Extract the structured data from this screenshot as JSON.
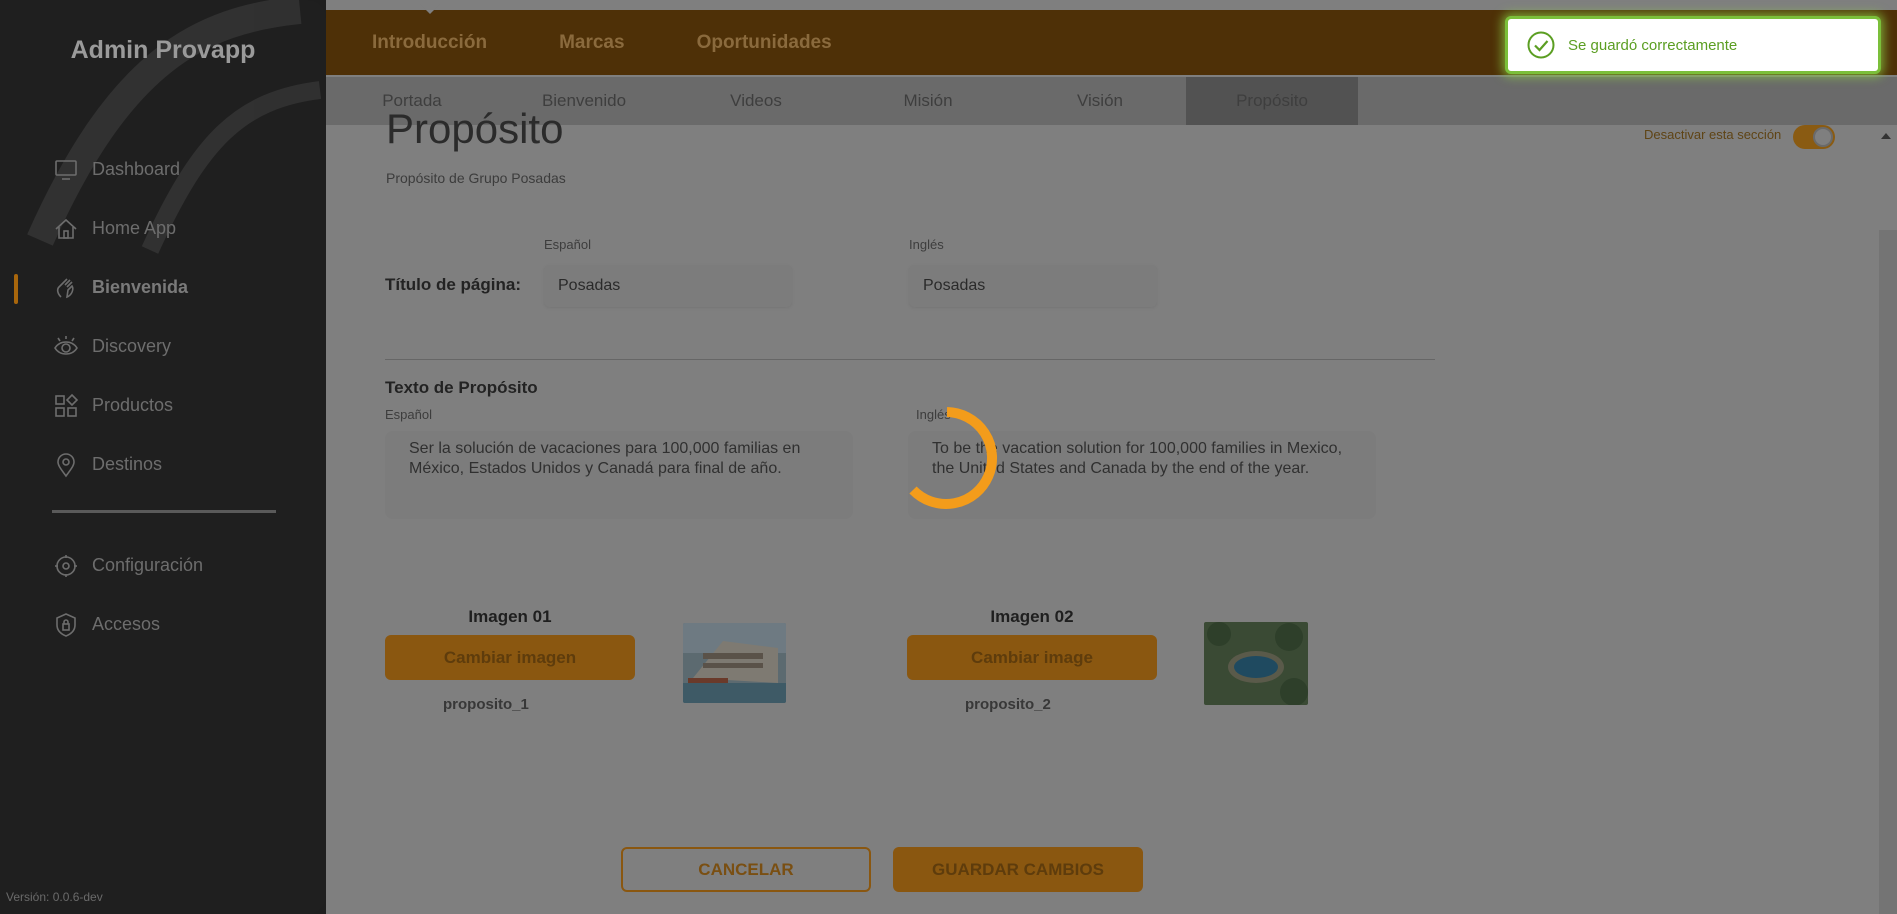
{
  "app": {
    "brand": "Admin Provapp",
    "version": "Versión: 0.0.6-dev"
  },
  "sidebar": {
    "items": [
      {
        "label": "Dashboard",
        "icon": "monitor-icon"
      },
      {
        "label": "Home App",
        "icon": "home-icon"
      },
      {
        "label": "Bienvenida",
        "icon": "wave-hand-icon",
        "active": true
      },
      {
        "label": "Discovery",
        "icon": "eye-icon"
      },
      {
        "label": "Productos",
        "icon": "grid-shapes-icon"
      },
      {
        "label": "Destinos",
        "icon": "location-pin-icon"
      }
    ],
    "secondary": [
      {
        "label": "Configuración",
        "icon": "gear-icon"
      },
      {
        "label": "Accesos",
        "icon": "shield-lock-icon"
      }
    ]
  },
  "topnav": {
    "tabs": [
      "Introducción",
      "Marcas",
      "Oportunidades"
    ],
    "active": "Introducción"
  },
  "subnav": {
    "tabs": [
      "Portada",
      "Bienvenido",
      "Videos",
      "Misión",
      "Visión",
      "Propósito"
    ],
    "active": "Propósito"
  },
  "page": {
    "title": "Propósito",
    "subtitle": "Propósito de Grupo Posadas",
    "toggle_label": "Desactivar esta sección"
  },
  "form": {
    "title_label": "Título de página:",
    "lang_es": "Español",
    "lang_en": "Inglés",
    "title_es": "Posadas",
    "title_en": "Posadas",
    "text_label": "Texto de Propósito",
    "text_lang_es": "Español",
    "text_lang_en": "Inglés",
    "text_es": "Ser la solución de vacaciones para 100,000 familias en México, Estados Unidos y Canadá para final de año.",
    "text_en": "To be the vacation solution for 100,000 families in Mexico, the United States and Canada by the end of the year."
  },
  "images": [
    {
      "title": "Imagen 01",
      "button": "Cambiar imagen",
      "name": "proposito_1"
    },
    {
      "title": "Imagen 02",
      "button": "Cambiar image",
      "name": "proposito_2"
    }
  ],
  "actions": {
    "cancel": "CANCELAR",
    "save": "GUARDAR CAMBIOS"
  },
  "toast": {
    "message": "Se guardó correctamente",
    "color": "#7bbf3a"
  },
  "colors": {
    "accent": "#f39c1b",
    "sidebar": "#1f1f1f"
  }
}
